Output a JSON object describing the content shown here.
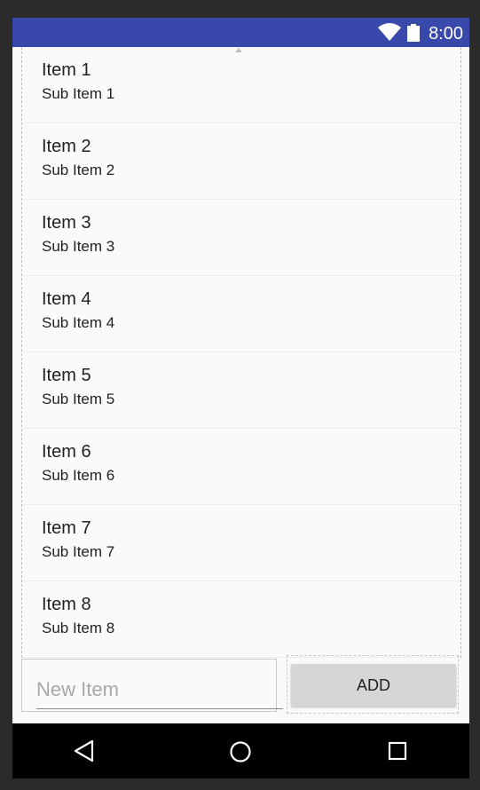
{
  "status_bar": {
    "time": "8:00"
  },
  "list": {
    "items": [
      {
        "title": "Item 1",
        "subtitle": "Sub Item 1"
      },
      {
        "title": "Item 2",
        "subtitle": "Sub Item 2"
      },
      {
        "title": "Item 3",
        "subtitle": "Sub Item 3"
      },
      {
        "title": "Item 4",
        "subtitle": "Sub Item 4"
      },
      {
        "title": "Item 5",
        "subtitle": "Sub Item 5"
      },
      {
        "title": "Item 6",
        "subtitle": "Sub Item 6"
      },
      {
        "title": "Item 7",
        "subtitle": "Sub Item 7"
      },
      {
        "title": "Item 8",
        "subtitle": "Sub Item 8"
      }
    ]
  },
  "input": {
    "placeholder": "New Item",
    "value": ""
  },
  "add_button": {
    "label": "ADD"
  },
  "colors": {
    "status_bar": "#3949ab",
    "background": "#fafafa",
    "button": "#d6d6d6",
    "nav_bar": "#000000"
  },
  "icons": {
    "wifi": "wifi-icon",
    "battery": "battery-icon",
    "back": "back-triangle-icon",
    "home": "home-circle-icon",
    "recents": "recents-square-icon"
  }
}
